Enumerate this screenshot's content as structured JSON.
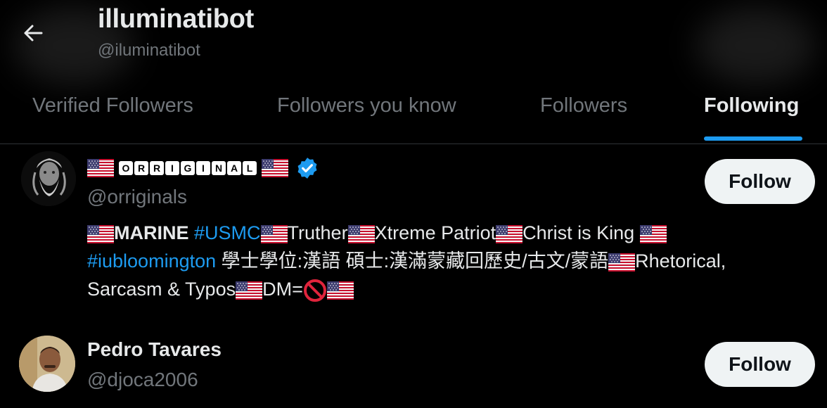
{
  "header": {
    "title": "illuminatibot",
    "handle": "@iluminatibot",
    "back_icon": "arrow-left-icon"
  },
  "tabs": [
    {
      "label": "Verified Followers",
      "active": false
    },
    {
      "label": "Followers you know",
      "active": false
    },
    {
      "label": "Followers",
      "active": false
    },
    {
      "label": "Following",
      "active": true
    }
  ],
  "users": [
    {
      "name_letters": [
        "O",
        "R",
        "R",
        "I",
        "G",
        "I",
        "N",
        "A",
        "L"
      ],
      "verified": true,
      "handle": "@orriginals",
      "follow_label": "Follow",
      "bio": {
        "marine": "MARINE",
        "tag_usmc": "#USMC",
        "truther": "Truther",
        "xtreme": "Xtreme Patriot",
        "christ": "Christ is King",
        "tag_iu": "#iubloomington",
        "chinese": " 學士學位:漢語 碩士:漢滿蒙藏回歷史/古文/蒙語",
        "rhetorical": "Rhetorical,",
        "sarcasm": "Sarcasm & Typos",
        "dm": "DM="
      }
    },
    {
      "name": "Pedro Tavares",
      "handle": "@djoca2006",
      "follow_label": "Follow"
    }
  ],
  "colors": {
    "background": "#000000",
    "accent": "#1d9bf0",
    "text_primary": "#e7e9ea",
    "text_secondary": "#71767b",
    "button_bg": "#eff3f4"
  }
}
